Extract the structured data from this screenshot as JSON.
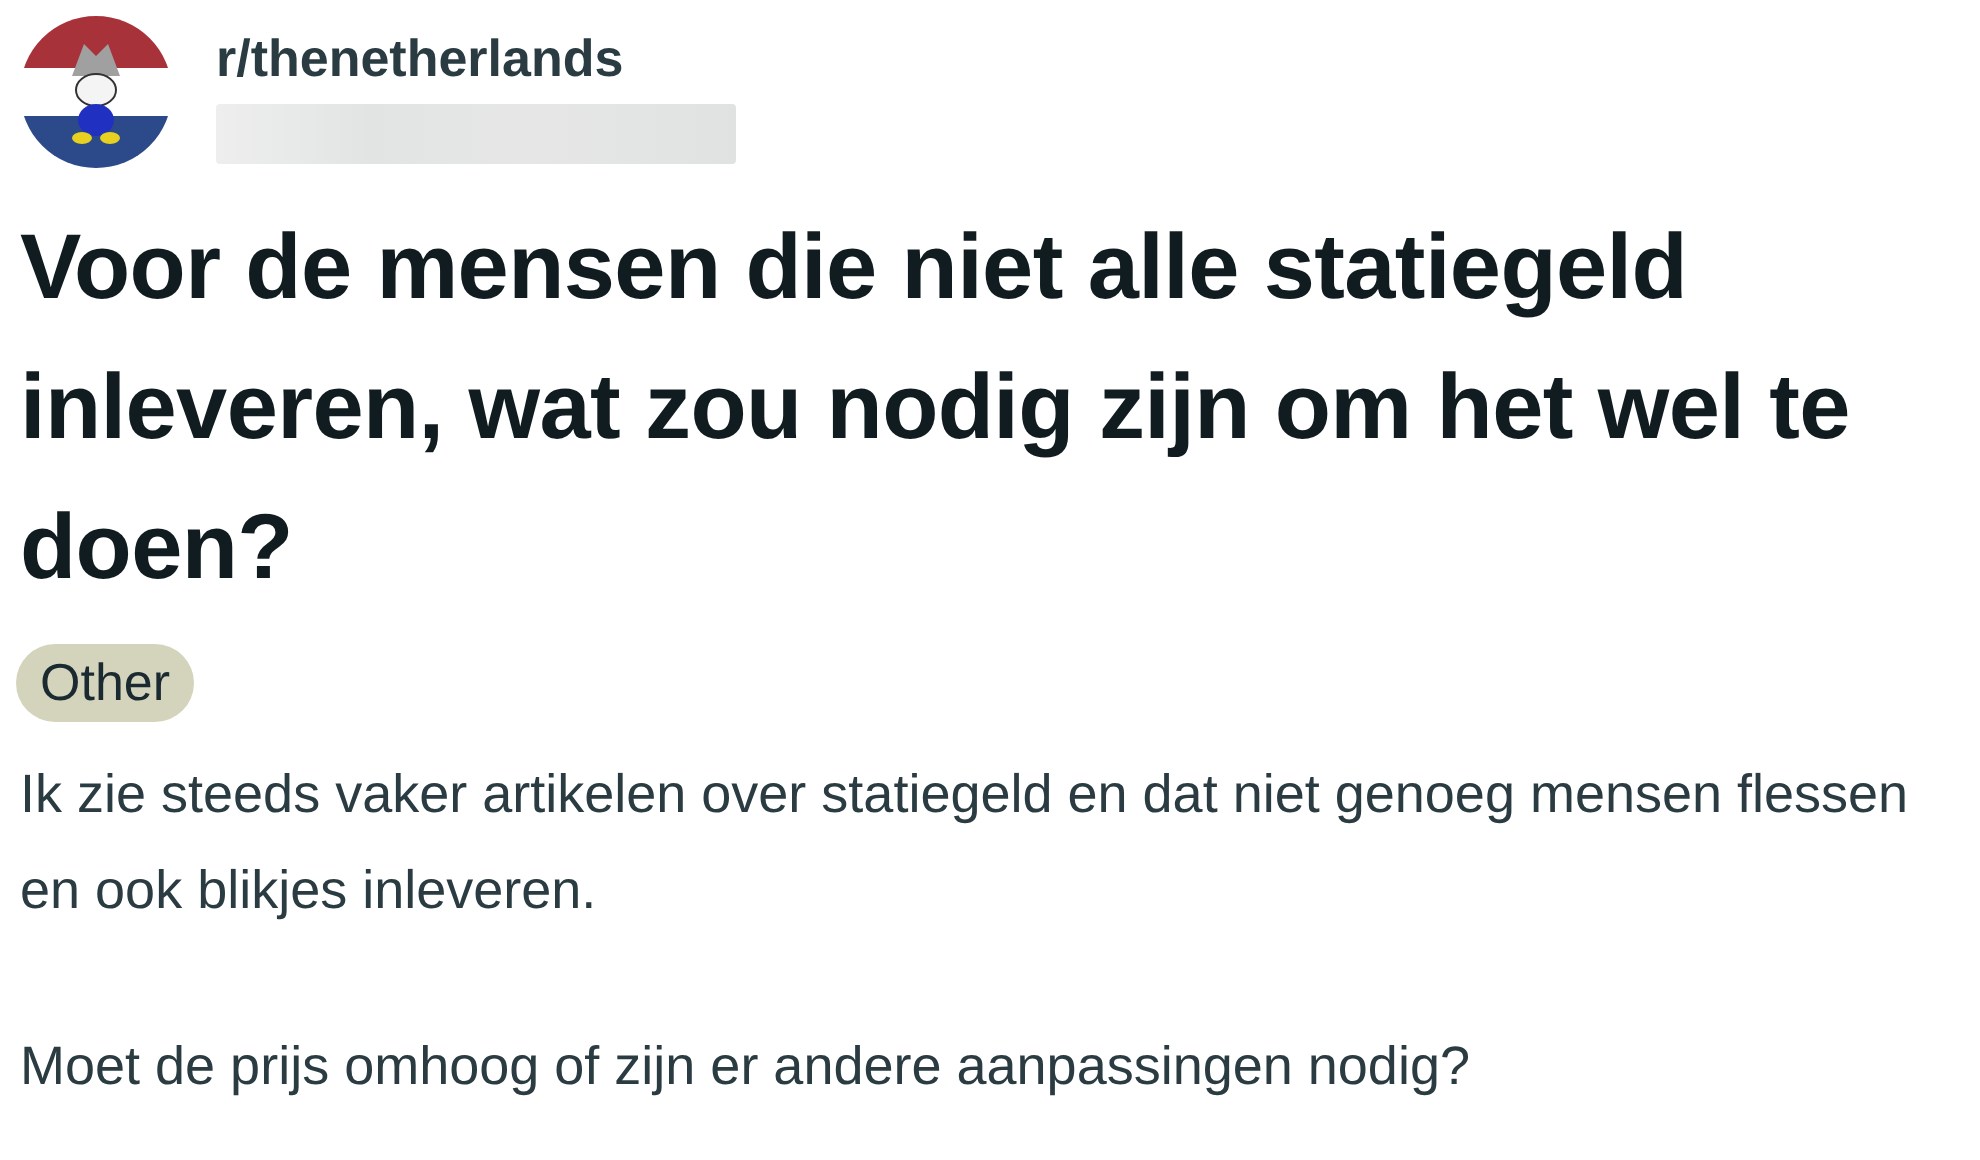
{
  "community": {
    "name": "r/thenetherlands"
  },
  "post": {
    "title": "Voor de mensen die niet alle statiegeld inleveren, wat zou nodig zijn om het wel te doen?",
    "flair": "Other",
    "body": [
      "Ik zie steeds vaker artikelen over statiegeld en dat niet genoeg mensen flessen en ook blikjes inleveren.",
      "Moet de prijs omhoog of zijn er andere aanpassingen nodig?"
    ]
  }
}
